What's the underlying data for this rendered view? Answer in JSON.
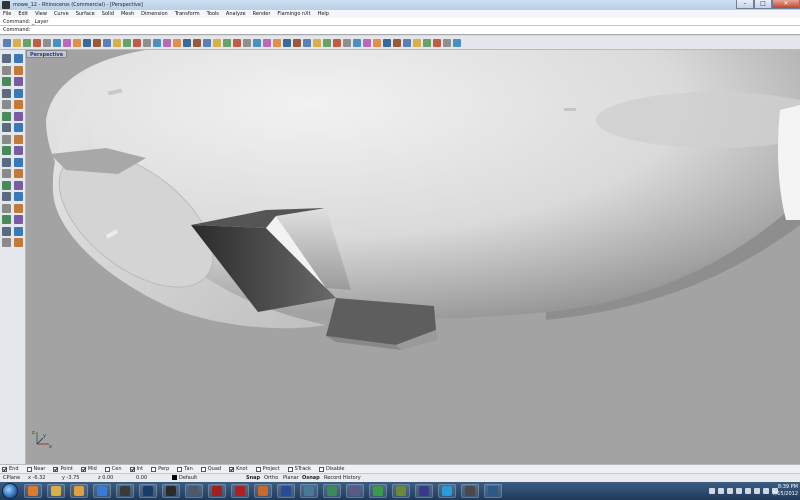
{
  "window": {
    "title": "mowe_12 - Rhinoceros (Commercial) - [Perspective]",
    "minimize": "–",
    "maximize": "□",
    "close": "✕"
  },
  "menu": [
    "File",
    "Edit",
    "View",
    "Curve",
    "Surface",
    "Solid",
    "Mesh",
    "Dimension",
    "Transform",
    "Tools",
    "Analyze",
    "Render",
    "Flamingo nXt",
    "Help"
  ],
  "command_history": "Command: _Layer",
  "command_line": {
    "label": "Command:",
    "value": ""
  },
  "toolbar_icons": [
    "new-icon",
    "open-icon",
    "save-icon",
    "print-icon",
    "import-icon",
    "cut-icon",
    "copy-icon",
    "paste-icon",
    "undo-icon",
    "pan-icon",
    "rotate-view-icon",
    "zoom-icon",
    "zoom-window-icon",
    "zoom-extents-icon",
    "zoom-selected-icon",
    "undo-view-icon",
    "set-cplane-icon",
    "four-viewports-icon",
    "options-icon",
    "select-icon",
    "hide-icon",
    "lock-icon",
    "layer-icon",
    "properties-icon",
    "render-icon",
    "material-icon",
    "rendered-display-icon",
    "sun-icon",
    "help-icon",
    "mesh-icon",
    "analysis-icon",
    "grid-icon",
    "snap-icon",
    "shade-icon",
    "curvature-icon",
    "zebra-icon",
    "draft-icon",
    "dimension-icon",
    "text-icon",
    "block-icon",
    "group-icon",
    "array-icon",
    "mirror-icon",
    "scale-icon",
    "move-icon",
    "paste-icon-2"
  ],
  "viewport": {
    "label": "Perspective",
    "axis_x": "x",
    "axis_y": "y",
    "axis_z": "z"
  },
  "osnaps": [
    {
      "label": "End",
      "checked": true
    },
    {
      "label": "Near",
      "checked": false
    },
    {
      "label": "Point",
      "checked": true
    },
    {
      "label": "Mid",
      "checked": true
    },
    {
      "label": "Cen",
      "checked": false
    },
    {
      "label": "Int",
      "checked": true
    },
    {
      "label": "Perp",
      "checked": false
    },
    {
      "label": "Tan",
      "checked": false
    },
    {
      "label": "Quad",
      "checked": false
    },
    {
      "label": "Knot",
      "checked": true
    },
    {
      "label": "Project",
      "checked": false
    },
    {
      "label": "STrack",
      "checked": false
    },
    {
      "label": "Disable",
      "checked": false
    }
  ],
  "coords": {
    "cplane": "CPlane",
    "x": "x -6.32",
    "y": "y -3.75",
    "z": "z 0.00",
    "d": "0.00",
    "layer": "Default"
  },
  "status_toggles": [
    "Snap",
    "Ortho",
    "Planar",
    "Osnap",
    "Record History"
  ],
  "clock": {
    "time": "8:39 PM",
    "date": "7/15/2012"
  },
  "colors": {
    "viewport_bg": "#a3a3a3",
    "title_bar": "#b8cfe8",
    "taskbar": "#1f3a5a",
    "viewport_label": "#1a3a8a"
  }
}
